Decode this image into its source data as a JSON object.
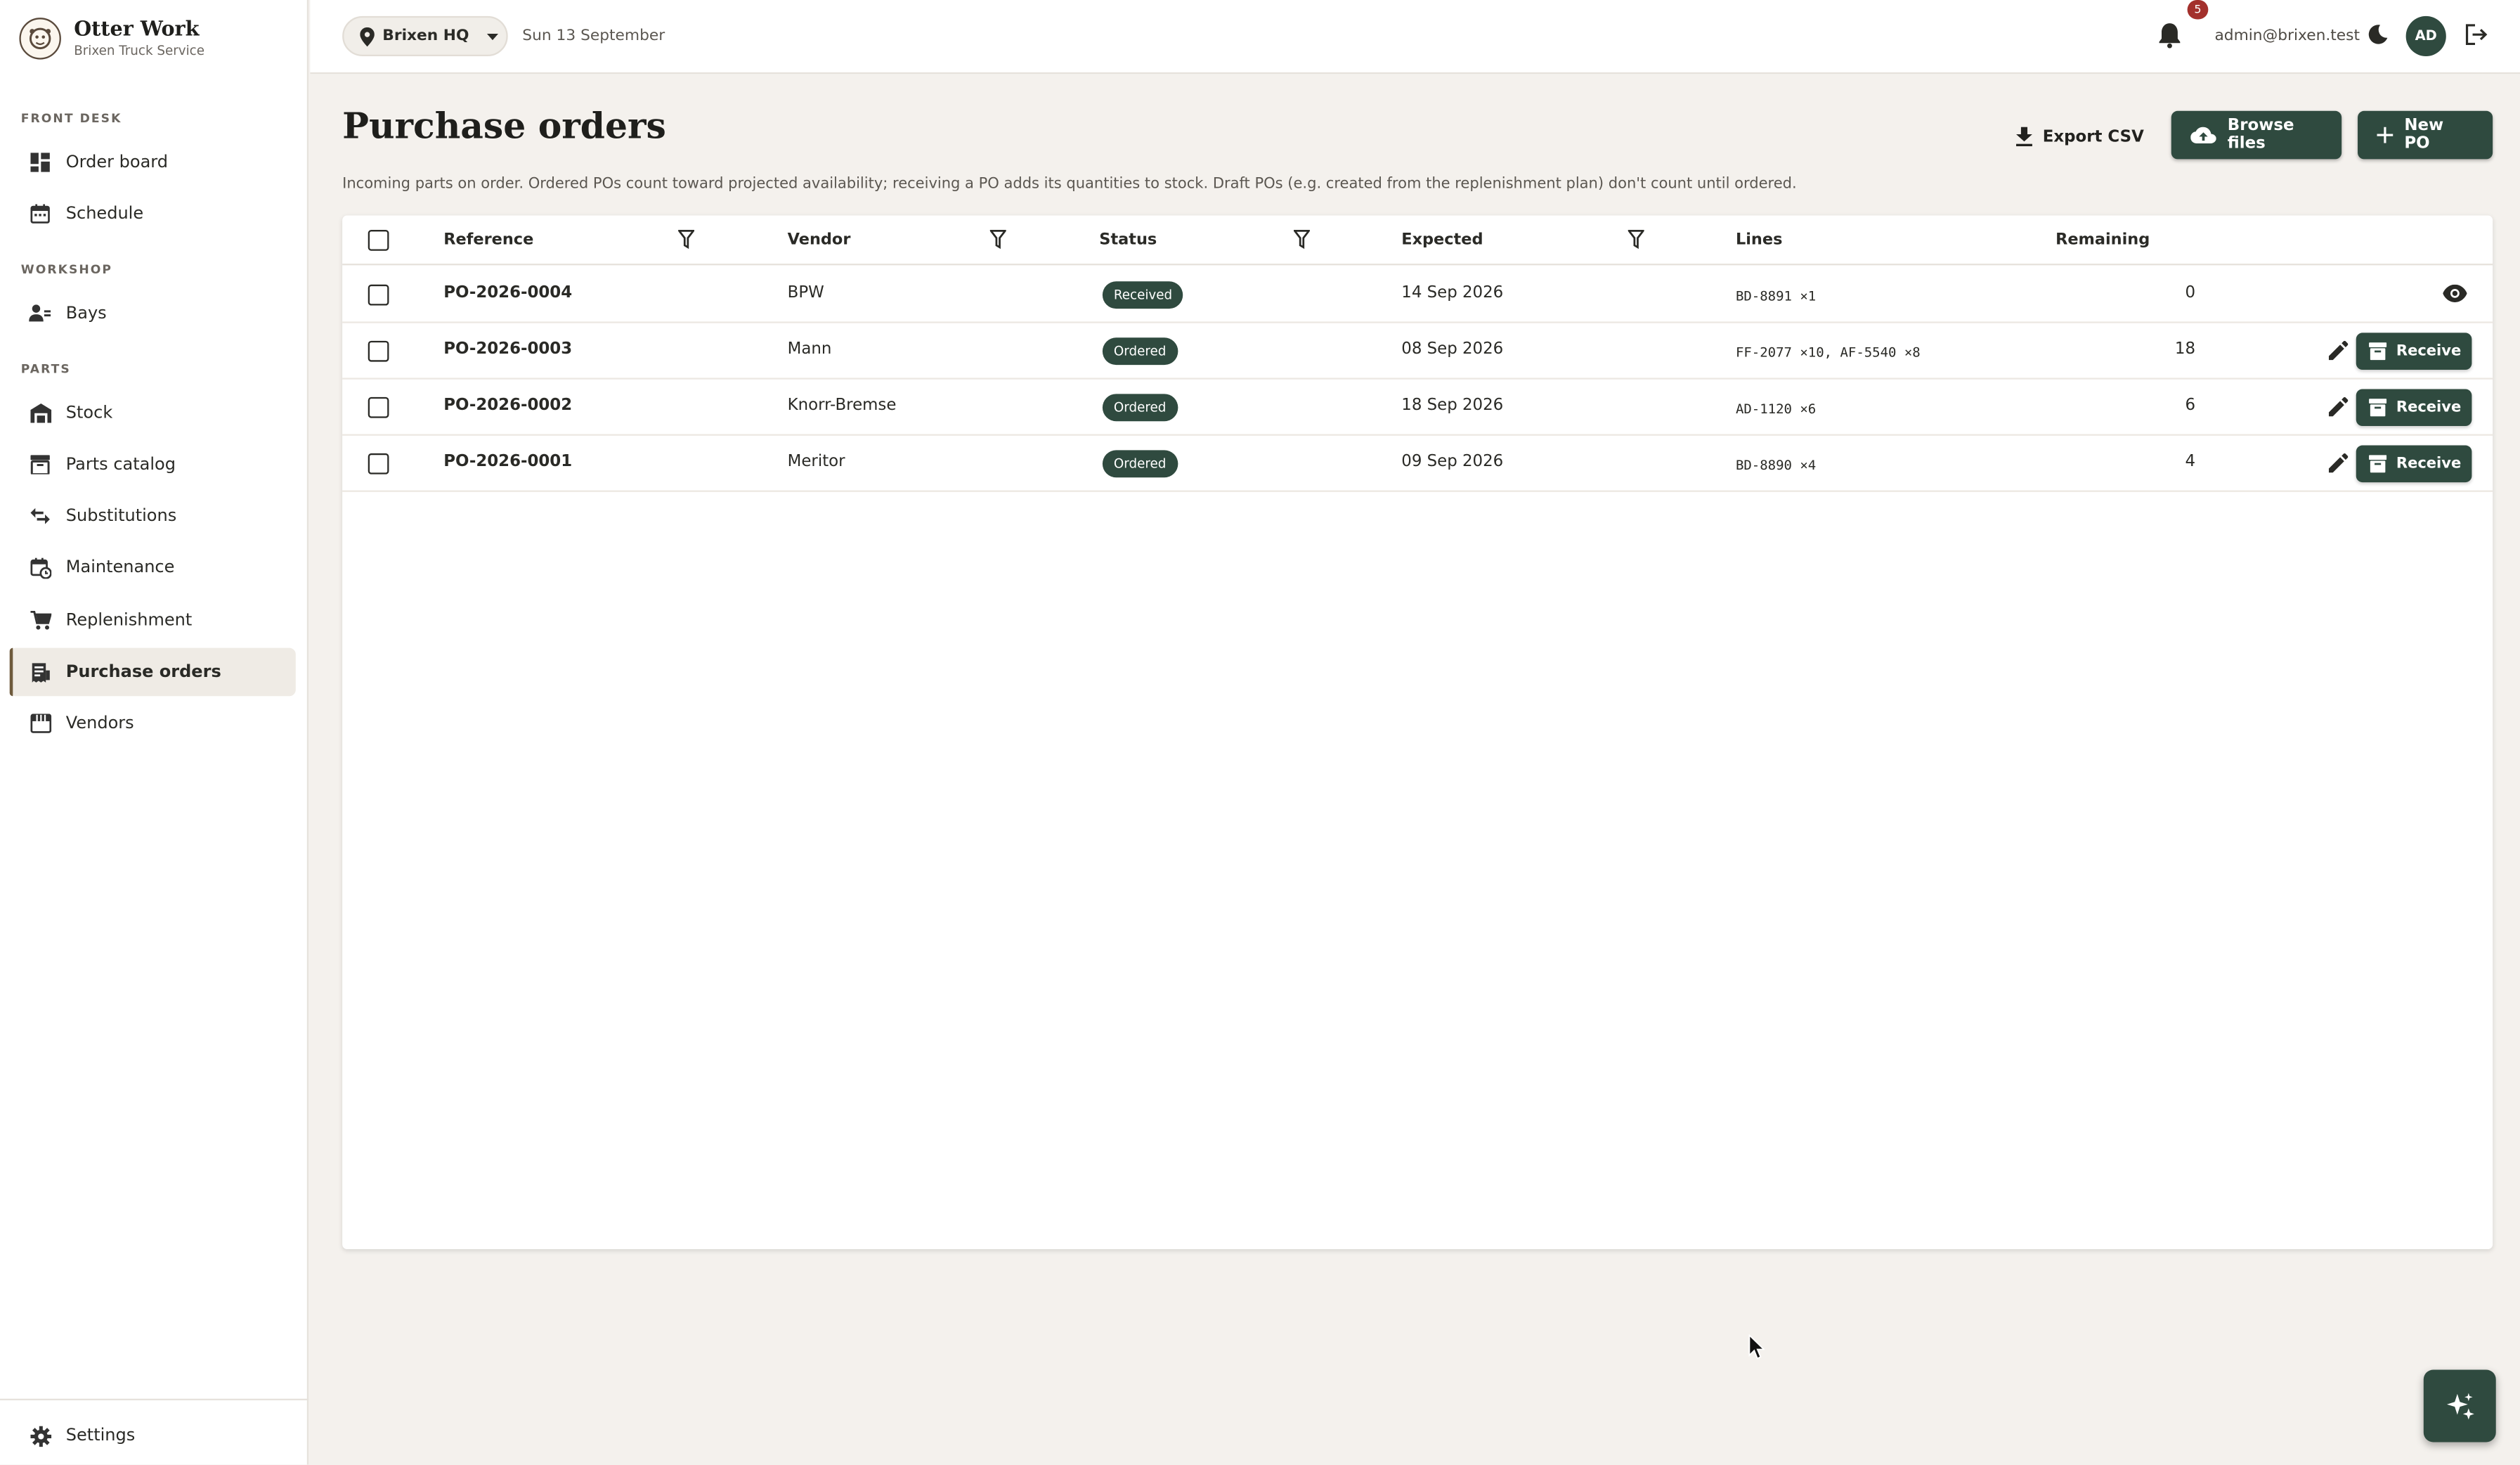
{
  "brand": {
    "title": "Otter Work",
    "subtitle": "Brixen Truck Service"
  },
  "sidebar": {
    "sections": [
      {
        "label": "FRONT DESK"
      },
      {
        "label": "WORKSHOP"
      },
      {
        "label": "PARTS"
      }
    ],
    "items": [
      {
        "label": "Order board",
        "icon": "dashboard-icon"
      },
      {
        "label": "Schedule",
        "icon": "calendar-icon"
      },
      {
        "label": "Bays",
        "icon": "bays-icon"
      },
      {
        "label": "Stock",
        "icon": "warehouse-icon"
      },
      {
        "label": "Parts catalog",
        "icon": "catalog-icon"
      },
      {
        "label": "Substitutions",
        "icon": "swap-icon"
      },
      {
        "label": "Maintenance",
        "icon": "calendar-clock-icon"
      },
      {
        "label": "Replenishment",
        "icon": "cart-icon"
      },
      {
        "label": "Purchase orders",
        "icon": "receipt-icon",
        "active": true
      },
      {
        "label": "Vendors",
        "icon": "store-icon"
      }
    ],
    "settings_label": "Settings"
  },
  "topbar": {
    "location": "Brixen HQ",
    "date": "Sun 13 September",
    "notification_count": "5",
    "user_email": "admin@brixen.test",
    "avatar_initials": "AD"
  },
  "page": {
    "title": "Purchase orders",
    "description": "Incoming parts on order. Ordered POs count toward projected availability; receiving a PO adds its quantities to stock. Draft POs (e.g. created from the replenishment plan) don't count until ordered.",
    "export_label": "Export CSV",
    "browse_label": "Browse files",
    "new_label": "New PO"
  },
  "table": {
    "columns": {
      "reference": "Reference",
      "vendor": "Vendor",
      "status": "Status",
      "expected": "Expected",
      "lines": "Lines",
      "remaining": "Remaining"
    },
    "receive_label": "Receive",
    "rows": [
      {
        "reference": "PO-2026-0004",
        "vendor": "BPW",
        "status": "Received",
        "expected": "14 Sep 2026",
        "lines": "BD-8891 ×1",
        "remaining": "0"
      },
      {
        "reference": "PO-2026-0003",
        "vendor": "Mann",
        "status": "Ordered",
        "expected": "08 Sep 2026",
        "lines": "FF-2077 ×10, AF-5540 ×8",
        "remaining": "18"
      },
      {
        "reference": "PO-2026-0002",
        "vendor": "Knorr-Bremse",
        "status": "Ordered",
        "expected": "18 Sep 2026",
        "lines": "AD-1120 ×6",
        "remaining": "6"
      },
      {
        "reference": "PO-2026-0001",
        "vendor": "Meritor",
        "status": "Ordered",
        "expected": "09 Sep 2026",
        "lines": "BD-8890 ×4",
        "remaining": "4"
      }
    ]
  },
  "colors": {
    "accent": "#2f4a3f",
    "badge": "#a3302c",
    "background": "#f4f1ed"
  }
}
